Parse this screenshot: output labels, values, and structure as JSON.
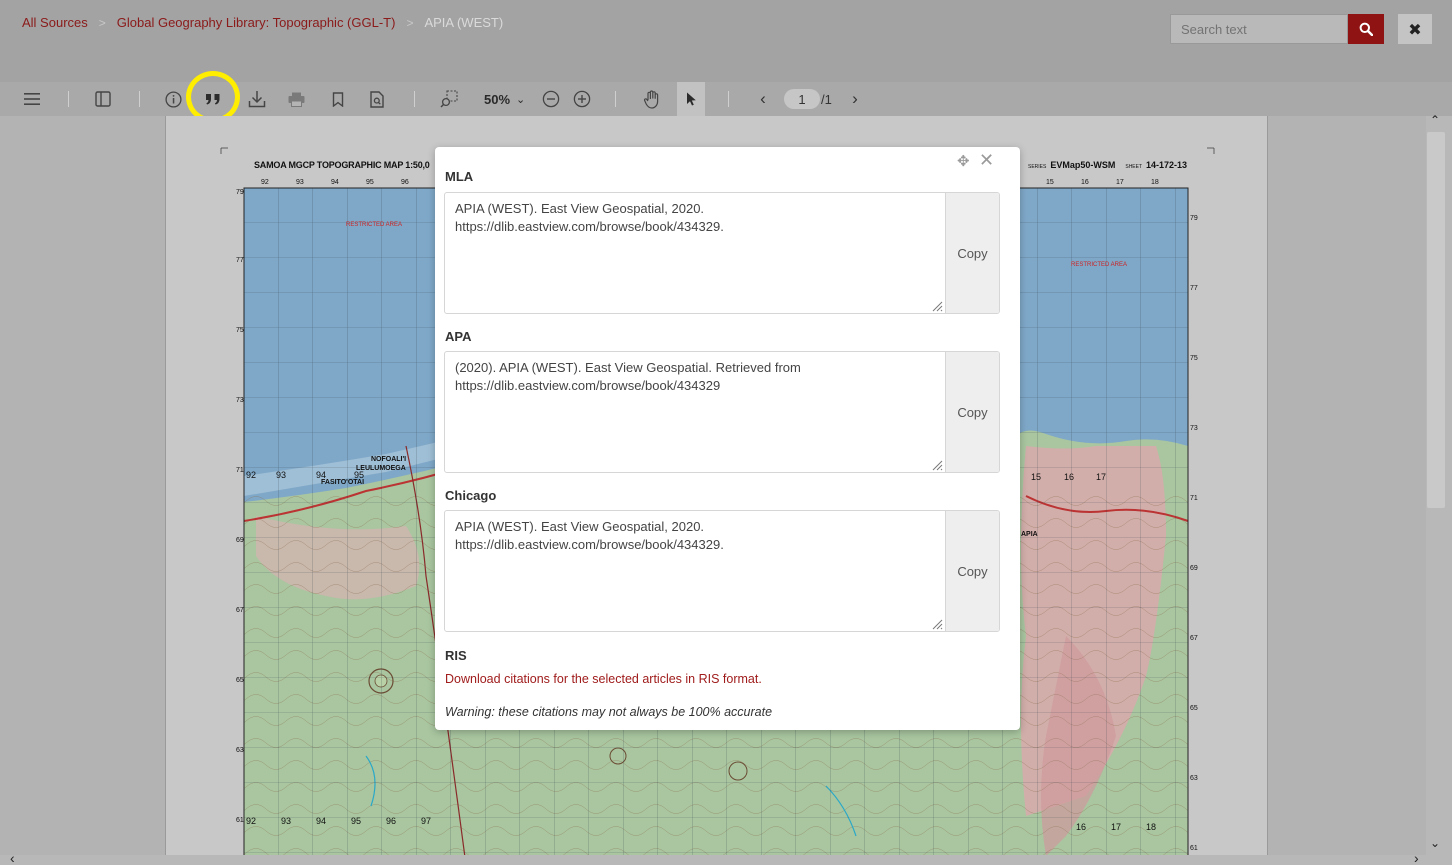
{
  "breadcrumb": {
    "items": [
      {
        "label": "All Sources"
      },
      {
        "label": "Global Geography Library: Topographic (GGL-T)"
      },
      {
        "label": "APIA (WEST)"
      }
    ],
    "separator": ">"
  },
  "search": {
    "placeholder": "Search text",
    "button_icon": "search-icon"
  },
  "close_button": {
    "label": "✖"
  },
  "toolbar": {
    "zoom": "50%",
    "page_current": "1",
    "page_total": "/1",
    "prev": "‹",
    "next": "›",
    "highlight_color": "#ffee00"
  },
  "map": {
    "title": "SAMOA   MGCP TOPOGRAPHIC MAP   1:50,0",
    "series_label": "SERIES",
    "series": "EVMap50-WSM",
    "sheet_label": "SHEET",
    "sheet": "14-172-13"
  },
  "citation": {
    "sections": [
      {
        "heading": "MLA",
        "text": "APIA (WEST). East View Geospatial, 2020. https://dlib.eastview.com/browse/book/434329.",
        "copy_label": "Copy"
      },
      {
        "heading": "APA",
        "text": "(2020). APIA (WEST). East View Geospatial. Retrieved from https://dlib.eastview.com/browse/book/434329",
        "copy_label": "Copy"
      },
      {
        "heading": "Chicago",
        "text": "APIA (WEST). East View Geospatial, 2020. https://dlib.eastview.com/browse/book/434329.",
        "copy_label": "Copy"
      }
    ],
    "ris_heading": "RIS",
    "ris_link": "Download citations for the selected articles in RIS format.",
    "warning": "Warning: these citations may not always be 100% accurate"
  },
  "colors": {
    "accent": "#8f1313",
    "link": "#a01c1c",
    "sea": "#7fa8c8",
    "land": "#a8c49a"
  }
}
